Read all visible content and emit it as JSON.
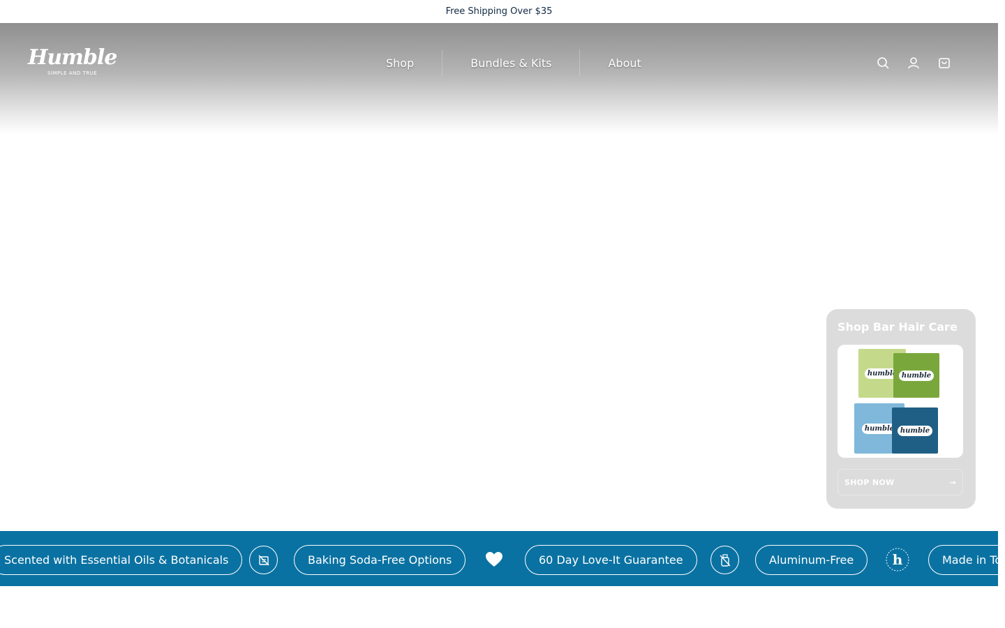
{
  "announcement": {
    "text": "Free Shipping Over $35"
  },
  "header": {
    "logo": {
      "wordmark": "Humble",
      "tagline": "SIMPLE AND TRUE",
      "registered": "®"
    },
    "nav": [
      {
        "label": "Shop"
      },
      {
        "label": "Bundles & Kits"
      },
      {
        "label": "About"
      }
    ],
    "icons": [
      "search-icon",
      "account-icon",
      "cart-icon"
    ]
  },
  "promo": {
    "title": "Shop Bar Hair Care",
    "product_brand": "humble",
    "cta_label": "SHOP NOW",
    "cta_arrow": "→"
  },
  "marquee": {
    "items": [
      {
        "label": "Scented with Essential Oils & Botanicals"
      },
      {
        "label": "Baking Soda-Free Options"
      },
      {
        "label": "60 Day Love-It Guarantee"
      },
      {
        "label": "Aluminum-Free"
      },
      {
        "label": "Made in To"
      }
    ],
    "icons": [
      "no-baking-soda-icon",
      "heart-icon",
      "no-aluminum-icon",
      "humble-badge-icon"
    ]
  },
  "colors": {
    "marquee_bg": "#0a72a2",
    "text_dark": "#102a43",
    "card_bg": "#dcdcdc"
  }
}
